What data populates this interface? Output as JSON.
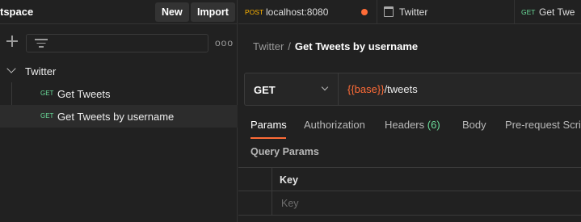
{
  "sidebar": {
    "workspace_title": "tspace",
    "new_button": "New",
    "import_button": "Import",
    "more_label": "ooo",
    "collection": {
      "name": "Twitter",
      "requests": [
        {
          "method": "GET",
          "name": "Get Tweets",
          "active": false
        },
        {
          "method": "GET",
          "name": "Get Tweets by username",
          "active": true
        }
      ]
    }
  },
  "tabs": [
    {
      "method": "POST",
      "title": "localhost:8080",
      "method_color": "#ffb400",
      "unsaved": true
    },
    {
      "icon": "collection-icon",
      "title": "Twitter"
    },
    {
      "method": "GET",
      "title": "Get Twe",
      "method_color": "#6bdd9a"
    }
  ],
  "breadcrumb": {
    "parent": "Twitter",
    "separator": "/",
    "current": "Get Tweets by username"
  },
  "request": {
    "method": "GET",
    "url_variable": "{{base}}",
    "url_path": "/tweets"
  },
  "request_tabs": [
    {
      "label": "Params",
      "active": true
    },
    {
      "label": "Authorization"
    },
    {
      "label": "Headers",
      "count": "(6)"
    },
    {
      "label": "Body"
    },
    {
      "label": "Pre-request Scri"
    }
  ],
  "query_params": {
    "label": "Query Params",
    "key_header": "Key",
    "key_placeholder": "Key"
  },
  "colors": {
    "accent": "#ff6c37",
    "get_method": "#6bdd9a",
    "post_method": "#ffb400",
    "background": "#212121"
  }
}
